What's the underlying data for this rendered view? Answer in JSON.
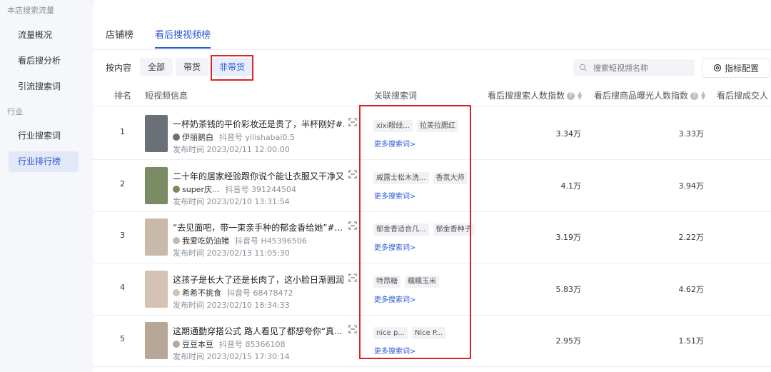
{
  "sidebar": {
    "group1": "本店搜索流量",
    "items1": [
      "流量概况",
      "看后搜分析",
      "引流搜索词"
    ],
    "group2": "行业",
    "items2": [
      "行业搜索词",
      "行业排行榜"
    ]
  },
  "tabs": [
    "店铺榜",
    "看后搜视频榜"
  ],
  "filter": {
    "label": "按内容",
    "options": [
      "全部",
      "带货",
      "非带货"
    ]
  },
  "search": {
    "placeholder": "搜索短视频名称"
  },
  "config_label": "指标配置",
  "columns": {
    "rank": "排名",
    "video": "短视频信息",
    "keywords": "关联搜索词",
    "search_index": "看后搜搜索人数指数",
    "exposure_index": "看后搜商品曝光人数指数",
    "deal_index": "看后搜成交人"
  },
  "more_label": "更多搜索词>",
  "rows": [
    {
      "rank": "1",
      "title": "一杯奶茶钱的平价彩妆还是贵了，半杯刚好#...",
      "user": "伊丽鹅白",
      "uid": "抖音号 yilishabai0.5",
      "time": "发布时间 2023/02/11 12:00:00",
      "tags": [
        "xixi眼线...",
        "拉美拉腮红"
      ],
      "search_index": "3.34万",
      "exposure_index": "3.33万",
      "thumb_color": "#6b6f78"
    },
    {
      "rank": "2",
      "title": "二十年的居家经验跟你说个能让衣服又干净又...",
      "user": "super庆...",
      "uid": "抖音号 391244504",
      "time": "发布时间 2023/02/10 13:31:54",
      "tags": [
        "威露士松木洗...",
        "香氛大师"
      ],
      "search_index": "4.1万",
      "exposure_index": "3.94万",
      "thumb_color": "#7a8a62"
    },
    {
      "rank": "3",
      "title": "“去见面吧，带一束亲手种的郁金香给她”#...",
      "user": "我爱吃奶油猪",
      "uid": "抖音号 H45396506",
      "time": "发布时间 2023/02/13 11:05:30",
      "tags": [
        "郁金香适合几...",
        "郁金香种子"
      ],
      "search_index": "3.19万",
      "exposure_index": "2.22万",
      "thumb_color": "#c9b9a8"
    },
    {
      "rank": "4",
      "title": "这孩子是长大了还是长肉了，这小脸日渐圆润...",
      "user": "希希不挑食",
      "uid": "抖音号 68478472",
      "time": "发布时间 2023/02/10 18:34:33",
      "tags": [
        "特昂糖",
        "糯糯玉米"
      ],
      "search_index": "5.83万",
      "exposure_index": "4.62万",
      "thumb_color": "#d6c2b4"
    },
    {
      "rank": "5",
      "title": "这期通勤穿搭公式 路人看见了都想夸你“真...",
      "user": "豆豆本豆",
      "uid": "抖音号 85366108",
      "time": "发布时间 2023/02/15 17:30:14",
      "tags": [
        "nice p...",
        "Nice P..."
      ],
      "search_index": "2.95万",
      "exposure_index": "1.51万",
      "thumb_color": "#b8a696"
    }
  ],
  "colors": {
    "accent": "#2b58d6",
    "highlight_box": "#dd2222"
  }
}
